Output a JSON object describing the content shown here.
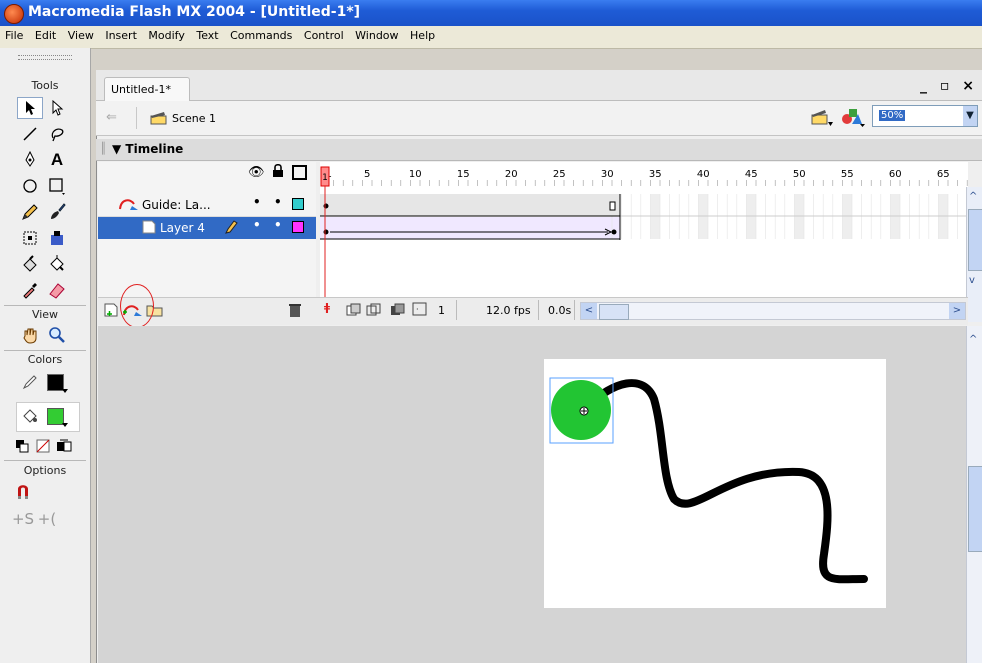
{
  "window": {
    "title": "Macromedia Flash MX 2004 - [Untitled-1*]"
  },
  "menu": [
    "File",
    "Edit",
    "View",
    "Insert",
    "Modify",
    "Text",
    "Commands",
    "Control",
    "Window",
    "Help"
  ],
  "tools": {
    "title": "Tools",
    "view_label": "View",
    "colors_label": "Colors",
    "options_label": "Options"
  },
  "document": {
    "tab_label": "Untitled-1*",
    "window_controls": "_ ▫ ×",
    "scene_label": "Scene 1",
    "zoom_value": "50%"
  },
  "timeline": {
    "header": "Timeline",
    "frame_numbers": [
      "1",
      "5",
      "10",
      "15",
      "20",
      "25",
      "30",
      "35",
      "40",
      "45",
      "50",
      "55",
      "60",
      "65"
    ],
    "layers": [
      {
        "name": "Guide: La...",
        "type": "guide",
        "outline_color": "#33cccc",
        "selected": false
      },
      {
        "name": "Layer 4",
        "type": "guided",
        "outline_color": "#ff33ff",
        "selected": true
      }
    ],
    "current_frame": "1",
    "fps": "12.0 fps",
    "elapsed": "0.0s"
  },
  "colors": {
    "stroke": "#000000",
    "fill": "#33cc33",
    "title_bar": "#1f5cd6",
    "selected_layer": "#316ac5",
    "playhead": "#ff4b4b",
    "annotation_circle": "#e02020"
  }
}
